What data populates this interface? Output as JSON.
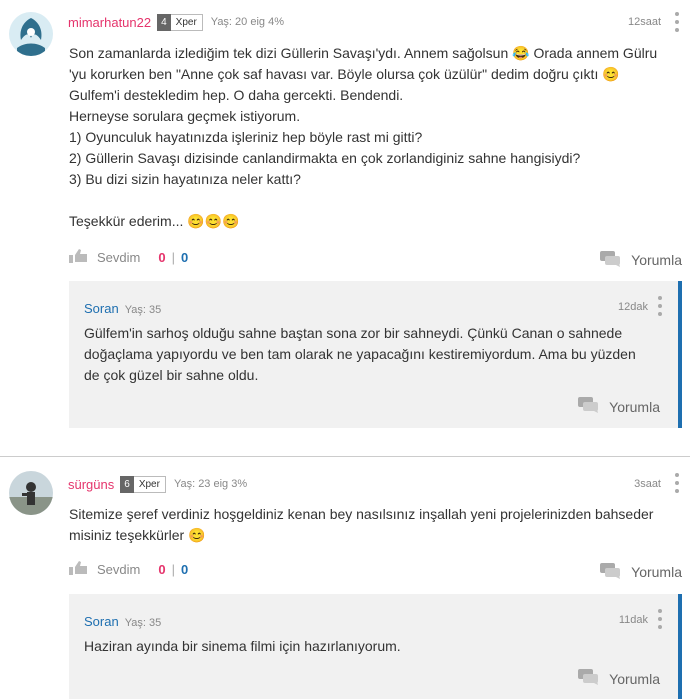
{
  "posts": [
    {
      "username": "mimarhatun22",
      "level": "4",
      "level_tag": "Xper",
      "age": "Yaş: 20 eig 4%",
      "time": "12saat",
      "body": [
        "Son zamanlarda izlediğim tek dizi Güllerin Savaşı'ydı. Annem sağolsun 😂 Orada annem Gülru",
        "'yu korurken ben \"Anne çok saf havası var. Böyle olursa çok üzülür\" dedim doğru çıktı 😊",
        "Gulfem'i destekledim hep. O daha gercekti. Bendendi.",
        "Herneyse sorulara geçmek istiyorum.",
        "1) Oyunculuk hayatınızda işleriniz hep böyle rast mi gitti?",
        "2) Güllerin Savaşı dizisinde canlandirmakta en çok zorlandiginiz sahne hangisiydi?",
        "3) Bu dizi sizin hayatınıza neler kattı?",
        "",
        "Teşekkür ederim... 😊😊😊"
      ],
      "like_label": "Sevdim",
      "likes": "0",
      "dislikes": "0",
      "comment_label": "Yorumla",
      "reply": {
        "name": "Soran",
        "age": "Yaş: 35",
        "time": "12dak",
        "text": [
          "Gülfem'in sarhoş olduğu sahne baştan sona zor bir sahneydi. Çünkü Canan o sahnede",
          "doğaçlama yapıyordu ve ben tam olarak ne yapacağını kestiremiyordum. Ama bu yüzden",
          "de çok güzel bir sahne oldu."
        ],
        "comment_label": "Yorumla"
      }
    },
    {
      "username": "sürgüns",
      "level": "6",
      "level_tag": "Xper",
      "age": "Yaş: 23 eig 3%",
      "time": "3saat",
      "body": [
        "Sitemize şeref verdiniz hoşgeldiniz kenan bey nasılsınız inşallah yeni projelerinizden bahseder",
        "misiniz teşekkürler 😊"
      ],
      "like_label": "Sevdim",
      "likes": "0",
      "dislikes": "0",
      "comment_label": "Yorumla",
      "reply": {
        "name": "Soran",
        "age": "Yaş: 35",
        "time": "11dak",
        "text": [
          "Haziran ayında bir sinema filmi için hazırlanıyorum."
        ],
        "comment_label": "Yorumla"
      }
    }
  ]
}
